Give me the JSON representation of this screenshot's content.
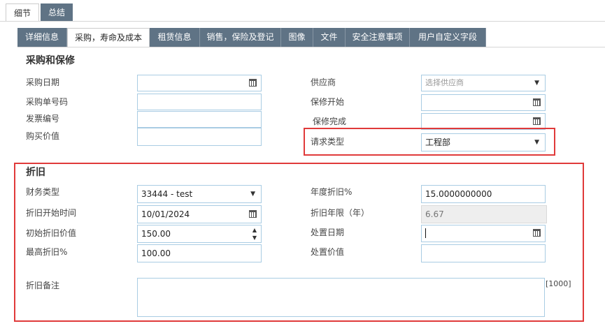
{
  "outer_tabs": [
    {
      "label": "细节"
    },
    {
      "label": "总结"
    }
  ],
  "inner_tabs": [
    {
      "label": "详细信息"
    },
    {
      "label": "采购，寿命及成本"
    },
    {
      "label": "租赁信息"
    },
    {
      "label": "销售，保险及登记"
    },
    {
      "label": "图像"
    },
    {
      "label": "文件"
    },
    {
      "label": "安全注意事项"
    },
    {
      "label": "用户自定义字段"
    }
  ],
  "purchase": {
    "title": "采购和保修",
    "purchase_date": {
      "label": "采购日期",
      "value": ""
    },
    "po_number": {
      "label": "采购单号码",
      "value": ""
    },
    "invoice_number": {
      "label": "发票编号",
      "value": ""
    },
    "purchase_value": {
      "label": "购买价值",
      "value": ""
    },
    "supplier": {
      "label": "供应商",
      "placeholder": "选择供应商"
    },
    "warranty_start": {
      "label": "保修开始",
      "value": ""
    },
    "warranty_end": {
      "label": "保修完成",
      "value": ""
    },
    "request_type": {
      "label": "请求类型",
      "value": "工程部"
    }
  },
  "depreciation": {
    "title": "折旧",
    "finance_type": {
      "label": "财务类型",
      "value": "33444 - test"
    },
    "start_date": {
      "label": "折旧开始时间",
      "value": "10/01/2024"
    },
    "initial_value": {
      "label": "初始折旧价值",
      "value": "150.00"
    },
    "max_percent": {
      "label": "最高折旧%",
      "value": "100.00"
    },
    "annual_percent": {
      "label": "年度折旧%",
      "value": "15.0000000000"
    },
    "years": {
      "label": "折旧年限（年）",
      "value": "6.67"
    },
    "disposal_date": {
      "label": "处置日期",
      "value": ""
    },
    "disposal_value": {
      "label": "处置价值",
      "value": ""
    },
    "notes": {
      "label": "折旧备注",
      "value": "",
      "max_length": "[1000]"
    }
  },
  "icons": {
    "calendar": "calendar-icon",
    "dropdown": "chevron-down-icon",
    "spinner": "spinner-arrows-icon"
  },
  "colors": {
    "tab_bg": "#5f7385",
    "field_border": "#a9cce3",
    "highlight": "#e03a3a"
  }
}
